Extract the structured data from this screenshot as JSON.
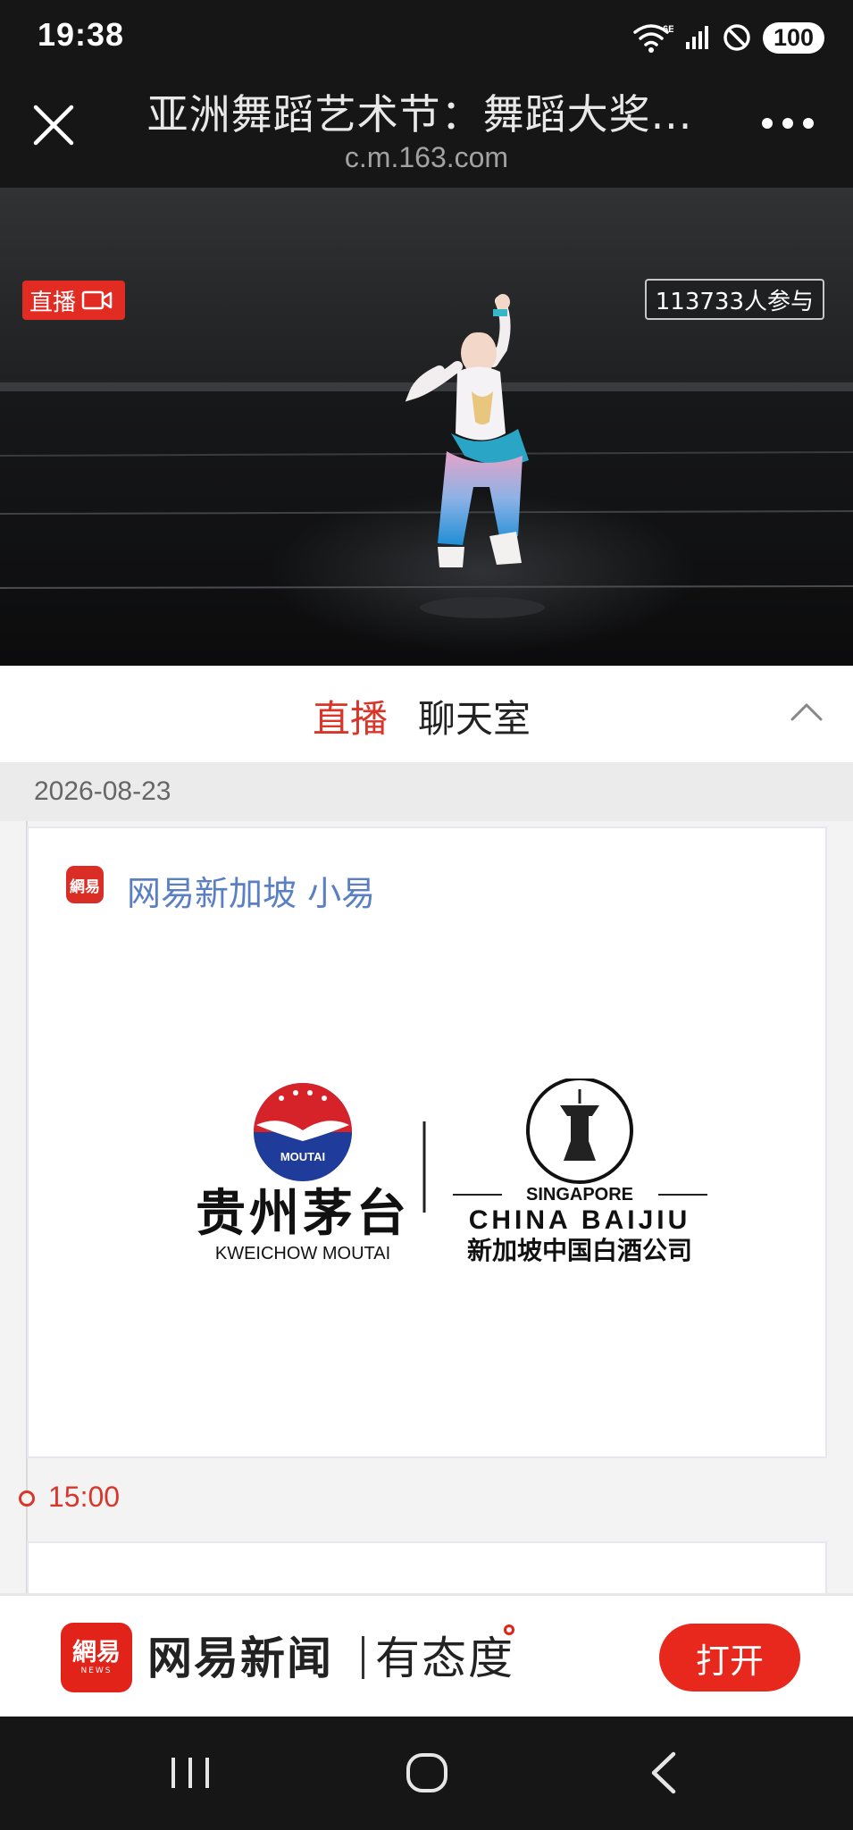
{
  "status_bar": {
    "time": "19:38",
    "network": "6E",
    "battery": "100",
    "icons": [
      "wifi-icon",
      "signal-icon",
      "do-not-disturb-icon",
      "battery-icon"
    ]
  },
  "browser": {
    "title": "亚洲舞蹈艺术节：舞蹈大奖...",
    "domain": "c.m.163.com",
    "close_icon": "close-icon",
    "more_icon": "more-icon"
  },
  "video": {
    "live_label": "直播",
    "viewers": "113733人参与",
    "colors": {
      "live_badge": "#e22b23"
    }
  },
  "tabs": {
    "live": "直播",
    "chat": "聊天室",
    "collapse_icon": "chevron-up-icon",
    "active_color": "#d9352a"
  },
  "feed": {
    "date": "2026-08-23",
    "posts": [
      {
        "author": "网易新加坡 小易",
        "author_icon_text": "網易",
        "image": {
          "left_logo_mark": "MOUTAI",
          "left_logo_cn": "贵州茅台",
          "left_logo_en": "KWEICHOW MOUTAI",
          "right_top": "SINGAPORE",
          "right_mid": "CHINA BAIJIU",
          "right_cn": "新加坡中国白酒公司"
        }
      }
    ],
    "time_marker": "15:00"
  },
  "app_banner": {
    "logo_cn": "網易",
    "logo_en": "NEWS",
    "app_name": "网易新闻",
    "slogan": "有态度",
    "open_button": "打开",
    "brand_color": "#e2231a"
  },
  "nav_bar": {
    "icons": [
      "recent-apps-icon",
      "home-icon",
      "back-icon"
    ]
  }
}
